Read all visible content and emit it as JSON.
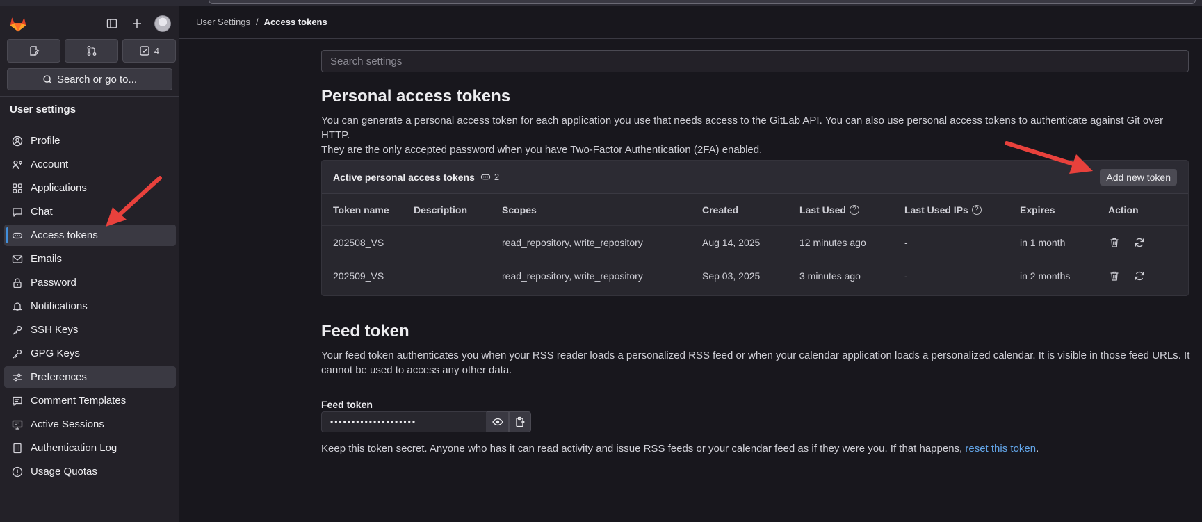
{
  "sidebar": {
    "quick_actions": [
      {
        "icon": "issues-icon",
        "count": ""
      },
      {
        "icon": "merge-request-icon",
        "count": ""
      },
      {
        "icon": "todo-icon",
        "count": "4"
      }
    ],
    "search_label": "Search or go to...",
    "section_title": "User settings",
    "items": [
      {
        "label": "Profile",
        "icon": "profile-icon"
      },
      {
        "label": "Account",
        "icon": "account-icon"
      },
      {
        "label": "Applications",
        "icon": "applications-icon"
      },
      {
        "label": "Chat",
        "icon": "chat-icon"
      },
      {
        "label": "Access tokens",
        "icon": "token-icon"
      },
      {
        "label": "Emails",
        "icon": "email-icon"
      },
      {
        "label": "Password",
        "icon": "lock-icon"
      },
      {
        "label": "Notifications",
        "icon": "bell-icon"
      },
      {
        "label": "SSH Keys",
        "icon": "key-icon"
      },
      {
        "label": "GPG Keys",
        "icon": "key-icon"
      },
      {
        "label": "Preferences",
        "icon": "preferences-icon"
      },
      {
        "label": "Comment Templates",
        "icon": "comment-icon"
      },
      {
        "label": "Active Sessions",
        "icon": "monitor-icon"
      },
      {
        "label": "Authentication Log",
        "icon": "log-icon"
      },
      {
        "label": "Usage Quotas",
        "icon": "quota-icon"
      }
    ]
  },
  "breadcrumb": {
    "parent": "User Settings",
    "separator": "/",
    "current": "Access tokens"
  },
  "search": {
    "placeholder": "Search settings"
  },
  "pat": {
    "title": "Personal access tokens",
    "description_line1": "You can generate a personal access token for each application you use that needs access to the GitLab API. You can also use personal access tokens to authenticate against Git over HTTP.",
    "description_line2": "They are the only accepted password when you have Two-Factor Authentication (2FA) enabled.",
    "card_title": "Active personal access tokens",
    "card_count": "2",
    "add_button": "Add new token",
    "columns": {
      "name": "Token name",
      "description": "Description",
      "scopes": "Scopes",
      "created": "Created",
      "last_used": "Last Used",
      "last_used_ips": "Last Used IPs",
      "expires": "Expires",
      "action": "Action"
    },
    "rows": [
      {
        "name": "202508_VS",
        "description": "",
        "scopes": "read_repository, write_repository",
        "created": "Aug 14, 2025",
        "last_used": "12 minutes ago",
        "ips": "-",
        "expires": "in 1 month"
      },
      {
        "name": "202509_VS",
        "description": "",
        "scopes": "read_repository, write_repository",
        "created": "Sep 03, 2025",
        "last_used": "3 minutes ago",
        "ips": "-",
        "expires": "in 2 months"
      }
    ]
  },
  "feed": {
    "title": "Feed token",
    "description_line1": "Your feed token authenticates you when your RSS reader loads a personalized RSS feed or when your calendar application loads a personalized calendar. It is visible in those feed URLs. It",
    "description_line2": "cannot be used to access any other data.",
    "label": "Feed token",
    "masked_value": "••••••••••••••••••••",
    "hint_text": "Keep this token secret. Anyone who has it can read activity and issue RSS feeds or your calendar feed as if they were you. If that happens, ",
    "hint_link": "reset this token",
    "hint_end": "."
  },
  "colors": {
    "accent": "#428fdc",
    "link": "#63a6e9",
    "annotation_arrow": "#e8413c"
  }
}
